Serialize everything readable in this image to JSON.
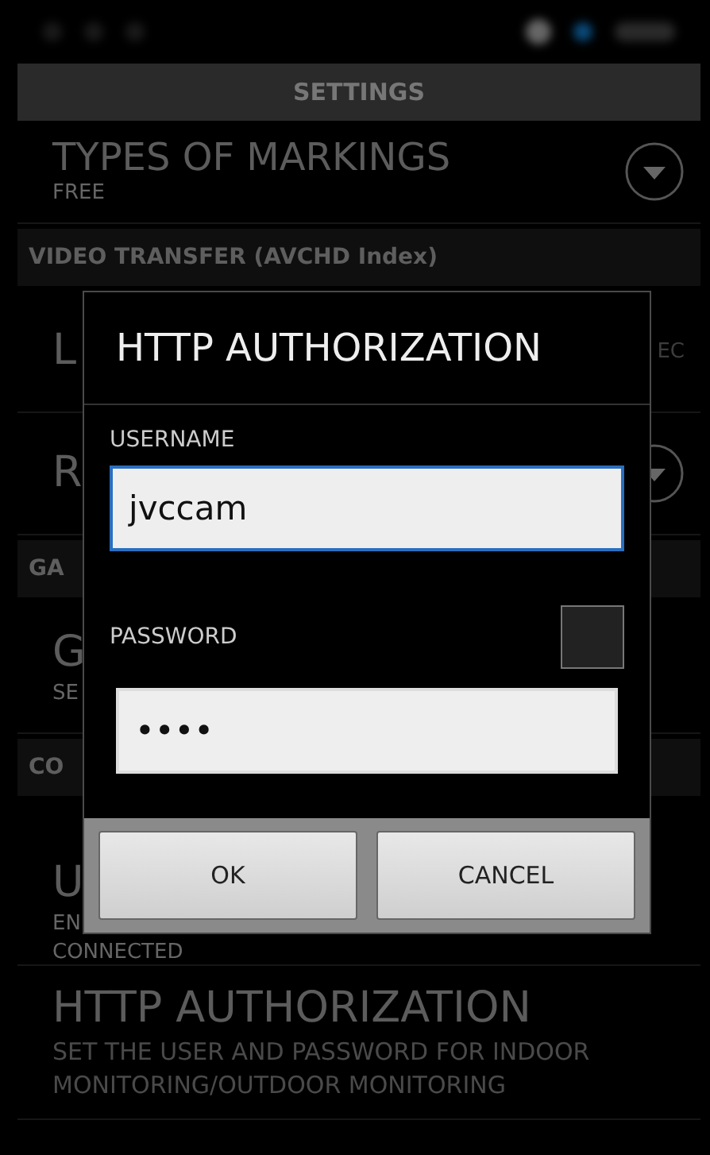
{
  "header": {
    "title": "SETTINGS"
  },
  "background_list": [
    {
      "kind": "row",
      "title": "TYPES OF MARKINGS",
      "subtitle": "FREE",
      "dropdown": true
    },
    {
      "kind": "section",
      "title": "VIDEO TRANSFER (AVCHD Index)"
    },
    {
      "kind": "row",
      "title": "L",
      "value": "EC"
    },
    {
      "kind": "row",
      "title": "R",
      "dropdown": true
    },
    {
      "kind": "section",
      "title": "GA"
    },
    {
      "kind": "row",
      "title": "G",
      "subtitle": "SE"
    },
    {
      "kind": "section",
      "title": "CO"
    },
    {
      "kind": "row",
      "title": "U",
      "subtitle": "EN",
      "subtitle_2": "CONNECTED"
    },
    {
      "kind": "row",
      "title": "HTTP AUTHORIZATION",
      "subtitle": "SET THE USER AND PASSWORD FOR INDOOR MONITORING/OUTDOOR MONITORING"
    }
  ],
  "dialog": {
    "title": "HTTP AUTHORIZATION",
    "username": {
      "label": "USERNAME",
      "value": "jvccam",
      "focused": true
    },
    "password": {
      "label": "PASSWORD",
      "value": "••••",
      "focused": false,
      "show_checked": false
    },
    "buttons": [
      "OK",
      "CANCEL"
    ]
  }
}
